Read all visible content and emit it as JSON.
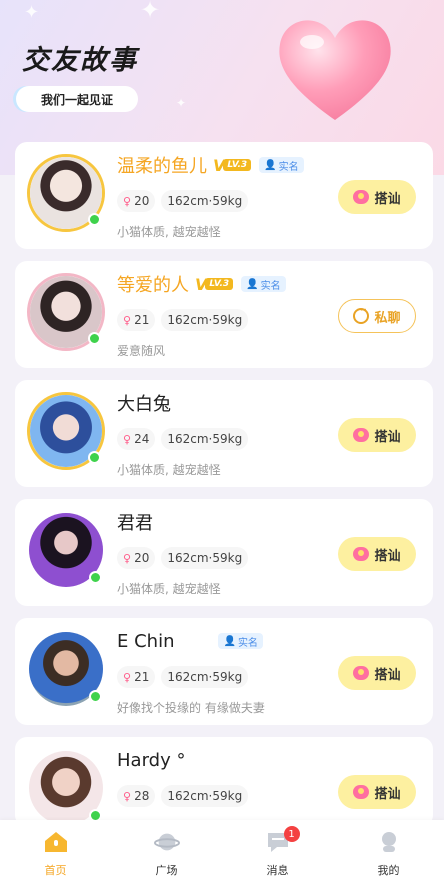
{
  "header": {
    "title": "交友故事",
    "subtitle": "我们一起见证"
  },
  "users": [
    {
      "name": "温柔的鱼儿",
      "vip": true,
      "level": "LV.3",
      "verified_label": "实名",
      "age": "20",
      "height_weight": "162cm·59kg",
      "desc": "小猫体质, 越宠越怪",
      "button": "搭讪",
      "button_type": "chat",
      "avatar_style": "gold"
    },
    {
      "name": "等爱的人",
      "vip": true,
      "level": "LV.3",
      "verified_label": "实名",
      "age": "21",
      "height_weight": "162cm·59kg",
      "desc": "爱意随风",
      "button": "私聊",
      "button_type": "msg",
      "avatar_style": "pink"
    },
    {
      "name": "大白兔",
      "vip": false,
      "age": "24",
      "height_weight": "162cm·59kg",
      "desc": "小猫体质, 越宠越怪",
      "button": "搭讪",
      "button_type": "chat",
      "avatar_style": "gold"
    },
    {
      "name": "君君",
      "vip": false,
      "age": "20",
      "height_weight": "162cm·59kg",
      "desc": "小猫体质, 越宠越怪",
      "button": "搭讪",
      "button_type": "chat",
      "avatar_style": "plain"
    },
    {
      "name": "E Chin",
      "vip": false,
      "verified_label": "实名",
      "age": "21",
      "height_weight": "162cm·59kg",
      "desc": "好像找个投缘的 有缘做夫妻",
      "button": "搭讪",
      "button_type": "chat",
      "avatar_style": "plain"
    },
    {
      "name": "Hardy °",
      "vip": false,
      "age": "28",
      "height_weight": "162cm·59kg",
      "desc": "",
      "button": "搭讪",
      "button_type": "chat",
      "avatar_style": "plain"
    }
  ],
  "tabbar": {
    "items": [
      {
        "label": "首页",
        "icon": "home-icon",
        "active": true
      },
      {
        "label": "广场",
        "icon": "planet-icon",
        "active": false
      },
      {
        "label": "消息",
        "icon": "message-icon",
        "active": false,
        "badge": "1"
      },
      {
        "label": "我的",
        "icon": "profile-icon",
        "active": false
      }
    ]
  },
  "colors": {
    "accent": "#f5a623",
    "online": "#3fd24c",
    "chat_button": "#fdf0a0",
    "badge": "#f44141"
  }
}
